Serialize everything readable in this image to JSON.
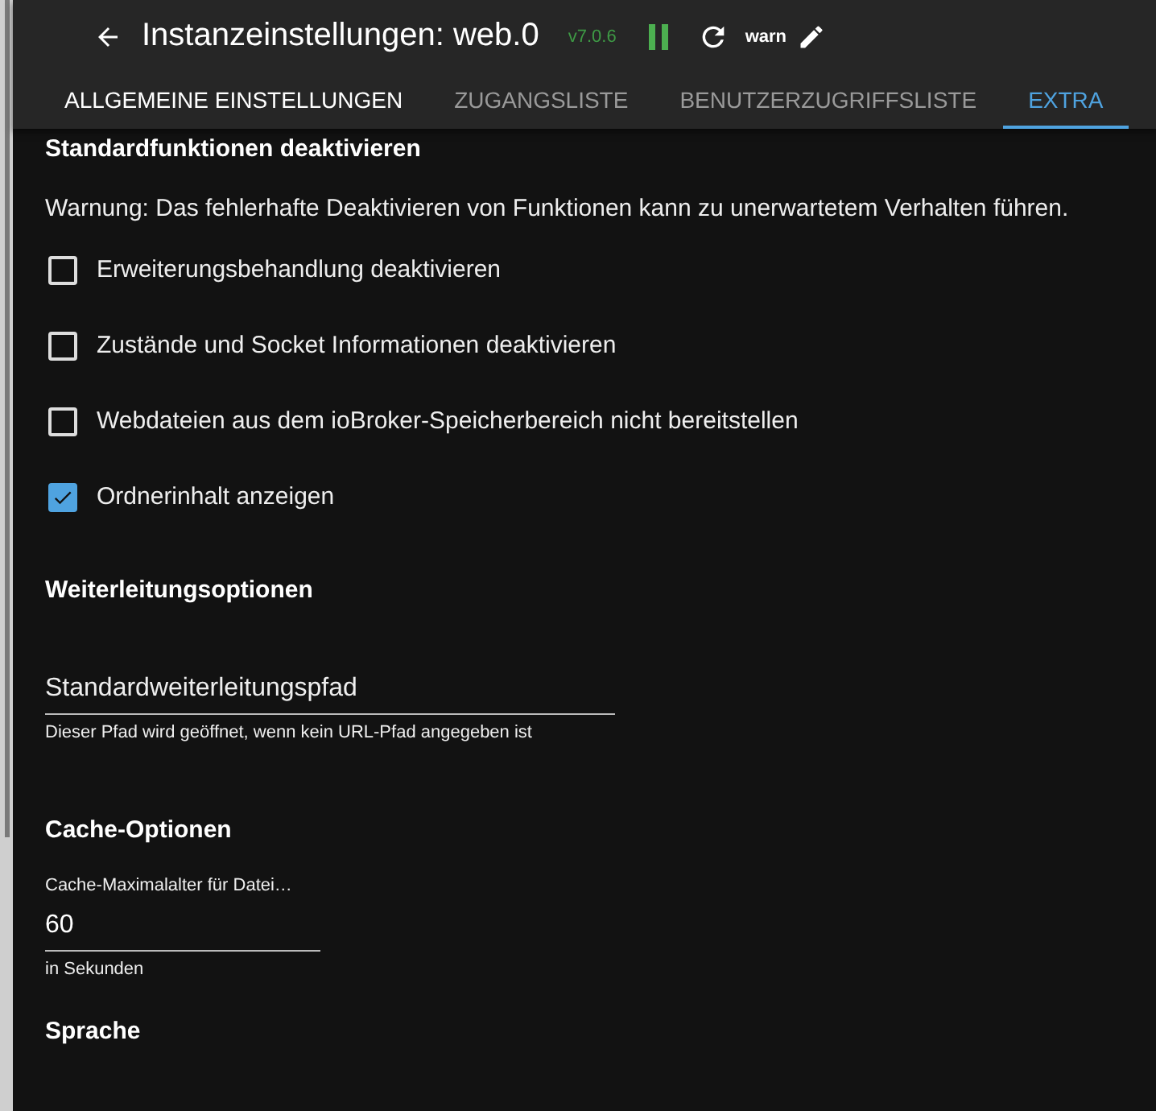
{
  "header": {
    "title": "Instanzeinstellungen: web.0",
    "version": "v7.0.6",
    "running": true,
    "log_level": "warn"
  },
  "tabs": [
    {
      "label": "ALLGEMEINE EINSTELLUNGEN",
      "selected": false,
      "hovered": true
    },
    {
      "label": "ZUGANGSLISTE",
      "selected": false,
      "hovered": false
    },
    {
      "label": "BENUTZERZUGRIFFSLISTE",
      "selected": false,
      "hovered": false
    },
    {
      "label": "EXTRA",
      "selected": true,
      "hovered": false
    }
  ],
  "sections": [
    {
      "kind": "checks",
      "heading": "Standardfunktionen deaktivieren",
      "note": "Warnung: Das fehlerhafte Deaktivieren von Funktionen kann zu unerwartetem Verhalten führen.",
      "items": [
        {
          "label": "Erweiterungsbehandlung deaktivieren",
          "checked": false
        },
        {
          "label": "Zustände und Socket Informationen deaktivieren",
          "checked": false
        },
        {
          "label": "Webdateien aus dem ioBroker-Speicherbereich nicht bereitstellen",
          "checked": false
        },
        {
          "label": "Ordnerinhalt anzeigen",
          "checked": true
        }
      ]
    },
    {
      "kind": "field",
      "heading": "Weiterleitungsoptionen",
      "placeholder": "Standardweiterleitungspfad",
      "helper": "Dieser Pfad wird geöffnet, wenn kein URL-Pfad angegeben ist"
    },
    {
      "kind": "field",
      "heading": "Cache-Optionen",
      "label": "Cache-Maximalalter für Datei…",
      "value": "60",
      "helper": "in Sekunden"
    },
    {
      "kind": "heading",
      "heading": "Sprache"
    }
  ]
}
